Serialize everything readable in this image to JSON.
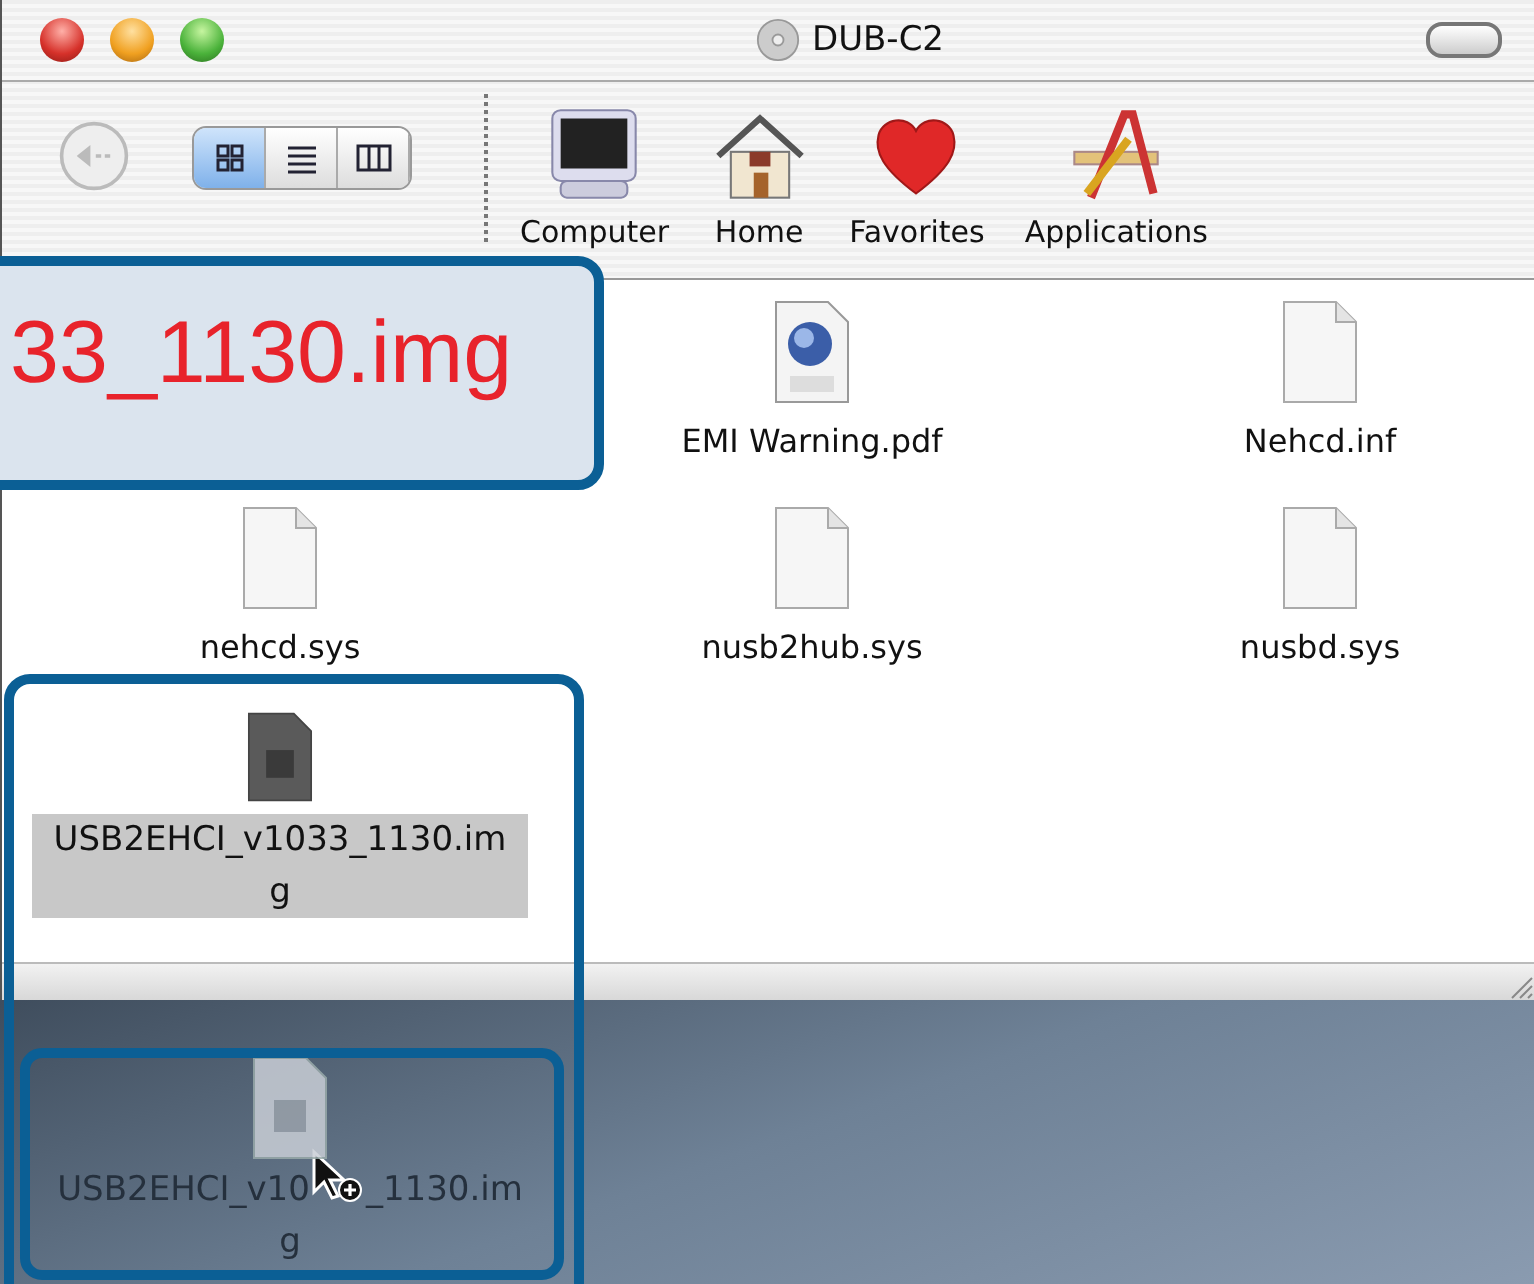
{
  "window": {
    "title": "DUB-C2"
  },
  "toolbar": {
    "view_modes": [
      {
        "kind": "icon",
        "selected": true
      },
      {
        "kind": "list",
        "selected": false
      },
      {
        "kind": "column",
        "selected": false
      }
    ],
    "places": [
      {
        "kind": "computer",
        "label": "Computer"
      },
      {
        "kind": "home",
        "label": "Home"
      },
      {
        "kind": "favorites",
        "label": "Favorites"
      },
      {
        "kind": "applications",
        "label": "Applications"
      }
    ]
  },
  "files": [
    {
      "kind": "pdf",
      "name": "EMI Warning.pdf",
      "selected": false
    },
    {
      "kind": "doc",
      "name": "Nehcd.inf",
      "selected": false
    },
    {
      "kind": "doc",
      "name": "nehcd.sys",
      "selected": false
    },
    {
      "kind": "doc",
      "name": "nusb2hub.sys",
      "selected": false
    },
    {
      "kind": "doc",
      "name": "nusbd.sys",
      "selected": false
    },
    {
      "kind": "image",
      "name": "USB2EHCI_v1033_1130.img",
      "selected": true
    }
  ],
  "callout": {
    "text": "33_1130.img"
  },
  "drag": {
    "label_parts": [
      "USB2EHCI_v10",
      "_1130.im",
      "g"
    ]
  }
}
